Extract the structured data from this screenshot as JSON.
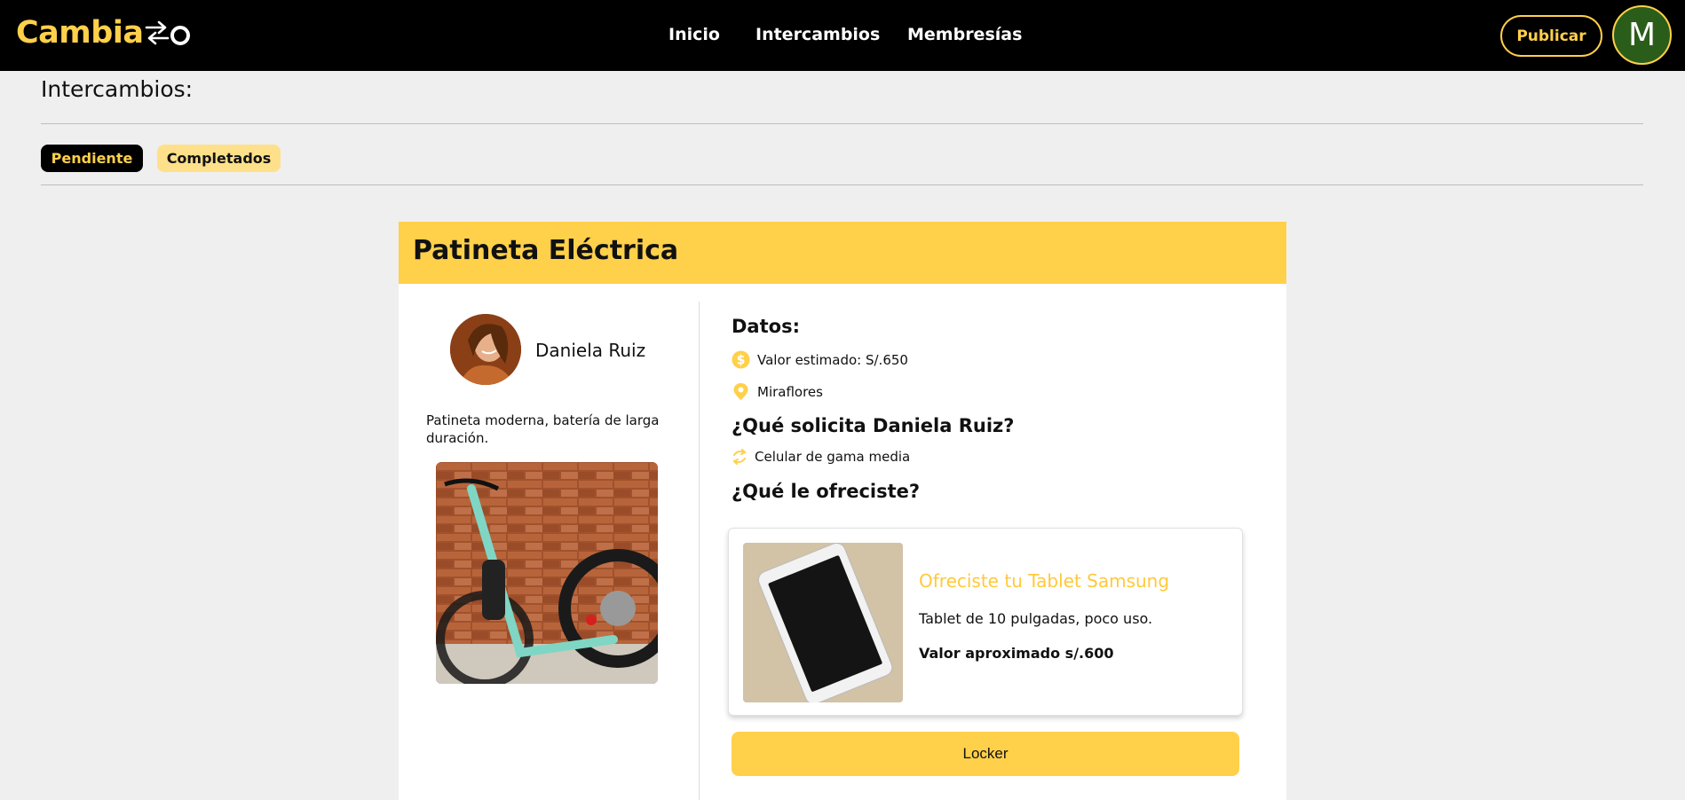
{
  "header": {
    "logo_text": "Cambia",
    "nav": [
      {
        "label": "Inicio"
      },
      {
        "label": "Intercambios"
      },
      {
        "label": "Membresías"
      }
    ],
    "publish_label": "Publicar",
    "avatar_initial": "M"
  },
  "page": {
    "title": "Intercambios:",
    "filters": {
      "pending_label": "Pendiente",
      "completed_label": "Completados"
    }
  },
  "exchange": {
    "item_title": "Patineta Eléctrica",
    "owner_name": "Daniela Ruiz",
    "item_description": "Patineta moderna, batería de larga duración.",
    "data_heading": "Datos:",
    "estimated_value": "Valor estimado: S/.650",
    "location": "Miraflores",
    "request_heading": "¿Qué solicita Daniela Ruiz?",
    "requested_item": "Celular de gama media",
    "offer_heading": "¿Qué le ofreciste?",
    "offer": {
      "title": "Ofreciste tu Tablet Samsung",
      "description": "Tablet de 10 pulgadas, poco uso.",
      "value": "Valor aproximado s/.600"
    },
    "locker_label": "Locker"
  },
  "colors": {
    "brand_yellow": "#ffd04a",
    "header_bg": "#000000",
    "page_bg": "#efefef",
    "avatar_bg": "#2b5d1a"
  },
  "icons": [
    "coin-icon",
    "location-pin-icon",
    "exchange-icon"
  ]
}
